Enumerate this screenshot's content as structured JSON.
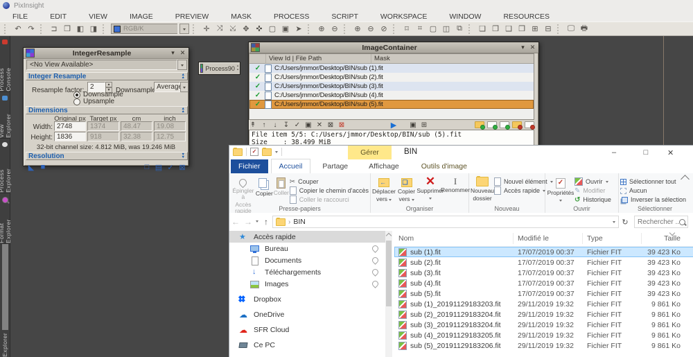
{
  "pixinsight": {
    "app_title": "PixInsight",
    "menus": [
      "FILE",
      "EDIT",
      "VIEW",
      "IMAGE",
      "PREVIEW",
      "MASK",
      "PROCESS",
      "SCRIPT",
      "WORKSPACE",
      "WINDOW",
      "RESOURCES"
    ],
    "channel_selector": "RGB/K",
    "side_tabs": [
      "Process Console",
      "View Explorer",
      "Process Explorer",
      "Format Explorer",
      "Explorer"
    ]
  },
  "integer_resample": {
    "title": "IntegerResample",
    "view_selector": "<No View Available>",
    "section_resample": "Integer Resample",
    "section_dimensions": "Dimensions",
    "section_resolution": "Resolution",
    "resample_factor_label": "Resample factor:",
    "resample_factor": "2",
    "downsample_mode_label": "Downsample mode:",
    "downsample_mode": "Average",
    "radio_downsample": "Downsample",
    "radio_upsample": "Upsample",
    "col_headers": [
      "Original px",
      "Target px",
      "cm",
      "inch"
    ],
    "width_label": "Width:",
    "height_label": "Height:",
    "width_values": [
      "2748",
      "1374",
      "48.47",
      "19.08"
    ],
    "height_values": [
      "1836",
      "918",
      "32.38",
      "12.75"
    ],
    "channel_size_note": "32-bit channel size: 4.812 MiB, was 19.246 MiB"
  },
  "process_icon": {
    "label": "Process90"
  },
  "image_container": {
    "title": "ImageContainer",
    "col_view_id": "View Id | File Path",
    "col_mask": "Mask",
    "rows": [
      {
        "path": "C:/Users/jmmor/Desktop/BIN/sub (1).fit"
      },
      {
        "path": "C:/Users/jmmor/Desktop/BIN/sub (2).fit"
      },
      {
        "path": "C:/Users/jmmor/Desktop/BIN/sub (3).fit"
      },
      {
        "path": "C:/Users/jmmor/Desktop/BIN/sub (4).fit"
      },
      {
        "path": "C:/Users/jmmor/Desktop/BIN/sub (5).fit",
        "selected": true
      }
    ],
    "status_line1": "File item 5/5: C:/Users/jmmor/Desktop/BIN/sub (5).fit",
    "status_line2": "Size    : 38.499 MiB",
    "selection_color": "#e0983f"
  },
  "explorer": {
    "window_title": "BIN",
    "contextual_tab": "Gérer",
    "contextual_color": "#ffe88a",
    "file_tab_color": "#1d4f9c",
    "tabs": [
      "Fichier",
      "Accueil",
      "Partage",
      "Affichage",
      "Outils d'image"
    ],
    "ribbon": {
      "pin_l1": "Épingler à",
      "pin_l2": "Accès rapide",
      "copy": "Copier",
      "paste": "Coller",
      "cut": "Couper",
      "copy_path": "Copier le chemin d'accès",
      "paste_shortcut": "Coller le raccourci",
      "group_clipboard": "Presse-papiers",
      "move_l1": "Déplacer",
      "move_l2": "vers",
      "copyto_l1": "Copier",
      "copyto_l2": "vers",
      "delete": "Supprimer",
      "rename": "Renommer",
      "group_organize": "Organiser",
      "newfolder_l1": "Nouveau",
      "newfolder_l2": "dossier",
      "new_item": "Nouvel élément",
      "quick_access": "Accès rapide",
      "group_new": "Nouveau",
      "properties": "Propriétés",
      "open": "Ouvrir",
      "edit": "Modifier",
      "history": "Historique",
      "group_open": "Ouvrir",
      "select_all": "Sélectionner tout",
      "select_none": "Aucun",
      "invert_selection": "Inverser la sélection",
      "group_select": "Sélectionner"
    },
    "breadcrumb": "BIN",
    "search_placeholder": "Rechercher ...",
    "nav": [
      {
        "label": "Accès rapide",
        "icon": "star",
        "selected": true
      },
      {
        "label": "Bureau",
        "icon": "desktop",
        "pinned": true,
        "indent": true
      },
      {
        "label": "Documents",
        "icon": "document",
        "pinned": true,
        "indent": true
      },
      {
        "label": "Téléchargements",
        "icon": "download",
        "pinned": true,
        "indent": true
      },
      {
        "label": "Images",
        "icon": "picture",
        "pinned": true,
        "indent": true
      },
      {
        "label": "Dropbox",
        "icon": "dropbox",
        "group": true
      },
      {
        "label": "OneDrive",
        "icon": "onedrive",
        "group": true
      },
      {
        "label": "SFR Cloud",
        "icon": "cloud",
        "group": true
      },
      {
        "label": "Ce PC",
        "icon": "computer",
        "group": true
      }
    ],
    "columns": {
      "name": "Nom",
      "date": "Modifié le",
      "type": "Type",
      "size": "Taille"
    },
    "selection_color": "#cce8ff",
    "files": [
      {
        "name": "sub (1).fit",
        "date": "17/07/2019 00:37",
        "type": "Fichier FIT",
        "size": "39 423 Ko",
        "selected": true
      },
      {
        "name": "sub (2).fit",
        "date": "17/07/2019 00:37",
        "type": "Fichier FIT",
        "size": "39 423 Ko"
      },
      {
        "name": "sub (3).fit",
        "date": "17/07/2019 00:37",
        "type": "Fichier FIT",
        "size": "39 423 Ko"
      },
      {
        "name": "sub (4).fit",
        "date": "17/07/2019 00:37",
        "type": "Fichier FIT",
        "size": "39 423 Ko"
      },
      {
        "name": "sub (5).fit",
        "date": "17/07/2019 00:37",
        "type": "Fichier FIT",
        "size": "39 423 Ko"
      },
      {
        "name": "sub (1)_20191129183203.fit",
        "date": "29/11/2019 19:32",
        "type": "Fichier FIT",
        "size": "9 861 Ko"
      },
      {
        "name": "sub (2)_20191129183204.fit",
        "date": "29/11/2019 19:32",
        "type": "Fichier FIT",
        "size": "9 861 Ko"
      },
      {
        "name": "sub (3)_20191129183204.fit",
        "date": "29/11/2019 19:32",
        "type": "Fichier FIT",
        "size": "9 861 Ko"
      },
      {
        "name": "sub (4)_20191129183205.fit",
        "date": "29/11/2019 19:32",
        "type": "Fichier FIT",
        "size": "9 861 Ko"
      },
      {
        "name": "sub (5)_20191129183206.fit",
        "date": "29/11/2019 19:32",
        "type": "Fichier FIT",
        "size": "9 861 Ko"
      }
    ]
  }
}
